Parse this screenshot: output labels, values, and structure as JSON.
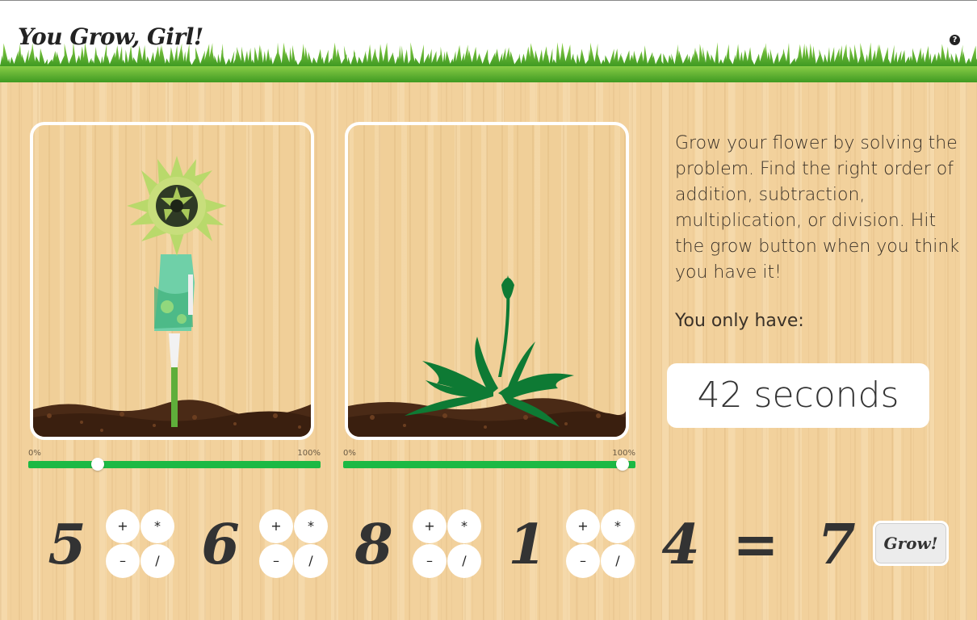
{
  "header": {
    "title": "You Grow, Girl!",
    "help_icon": "?"
  },
  "plants": [
    {
      "name": "target",
      "progress_min_label": "0%",
      "progress_max_label": "100%",
      "progress_percent": 25
    },
    {
      "name": "player",
      "progress_min_label": "0%",
      "progress_max_label": "100%",
      "progress_percent": 100
    }
  ],
  "instructions": {
    "text": "Grow your flower by solving the problem. Find the right order of addition, subtraction, multiplication, or division. Hit the grow button when you think you have it!",
    "time_label": "You only have:"
  },
  "timer": {
    "text": "42 seconds"
  },
  "equation": {
    "numbers": [
      "5",
      "6",
      "8",
      "1",
      "4"
    ],
    "equals": "=",
    "result": "7",
    "operators": {
      "plus": "+",
      "times": "*",
      "minus": "–",
      "divide": "∕"
    }
  },
  "grow_button": {
    "label": "Grow!"
  },
  "colors": {
    "progress": "#1cb944",
    "leaf": "#0e7a34",
    "soil": "#4a2a16",
    "dress": "#6fd0a8"
  }
}
